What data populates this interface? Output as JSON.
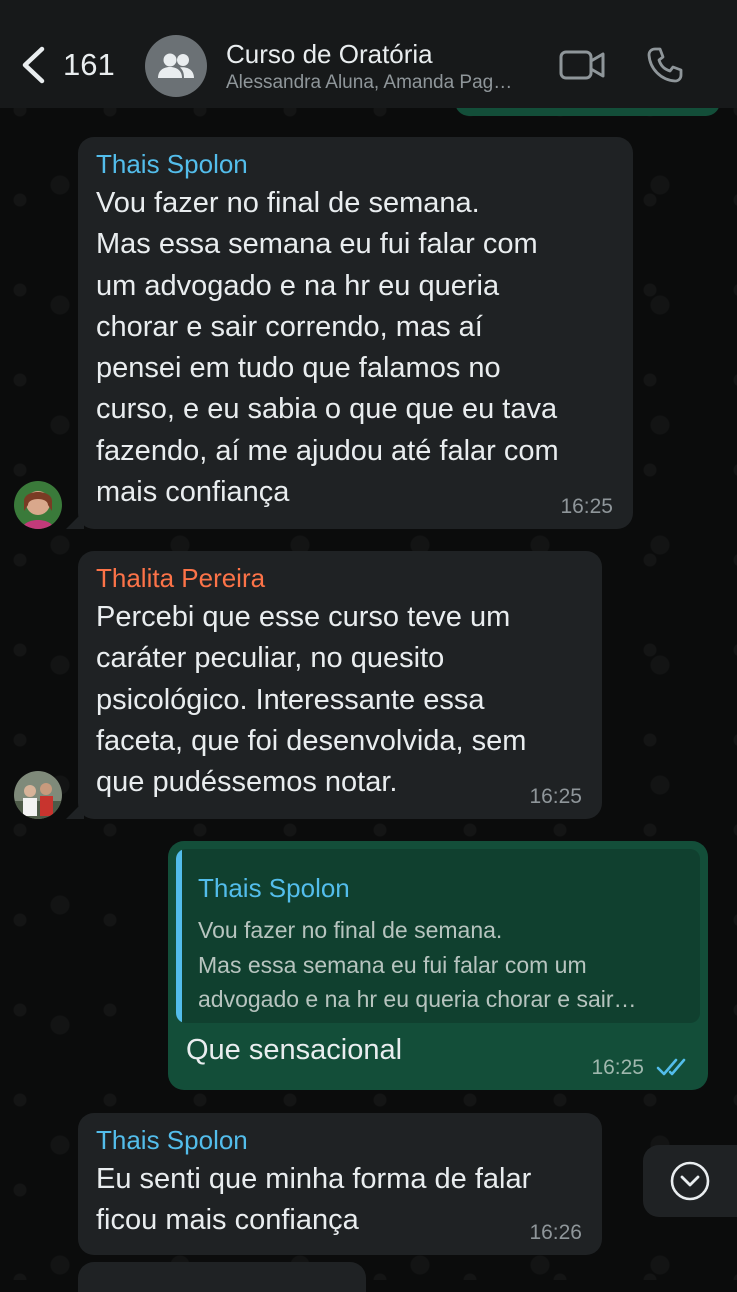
{
  "header": {
    "back_count": "161",
    "group_name": "Curso de Oratória",
    "members": "Alessandra Aluna, Amanda Pag…"
  },
  "messages": [
    {
      "sender": "Thais Spolon",
      "sender_color": "#53bdeb",
      "text": "Vou fazer no final de semana.\nMas essa semana eu fui falar com\num advogado e na hr eu queria\nchorar e sair correndo, mas aí\npensei em tudo que falamos no\ncurso, e eu sabia o que que eu tava\nfazendo, aí me ajudou até falar com\nmais confiança",
      "time": "16:25"
    },
    {
      "sender": "Thalita Pereira",
      "sender_color": "#fc7348",
      "text": "Percebi que esse curso teve um\ncaráter peculiar, no quesito\npsicológico. Interessante essa\nfaceta, que foi desenvolvida, sem\nque pudéssemos notar.",
      "time": "16:25"
    },
    {
      "quoted_sender": "Thais Spolon",
      "quoted_text": "Vou fazer no final de semana.\nMas essa semana eu fui falar com um\nadvogado e na hr eu queria chorar e sair…",
      "text": "Que sensacional",
      "time": "16:25",
      "status_icon": "double-check-read-icon"
    },
    {
      "sender": "Thais Spolon",
      "sender_color": "#53bdeb",
      "text": "Eu senti que minha forma de falar\nficou mais confiança",
      "time": "16:26"
    }
  ],
  "icons": {
    "back": "chevron-left-icon",
    "group": "group-icon",
    "video": "video-camera-icon",
    "phone": "phone-icon",
    "scroll": "chevron-down-icon"
  }
}
